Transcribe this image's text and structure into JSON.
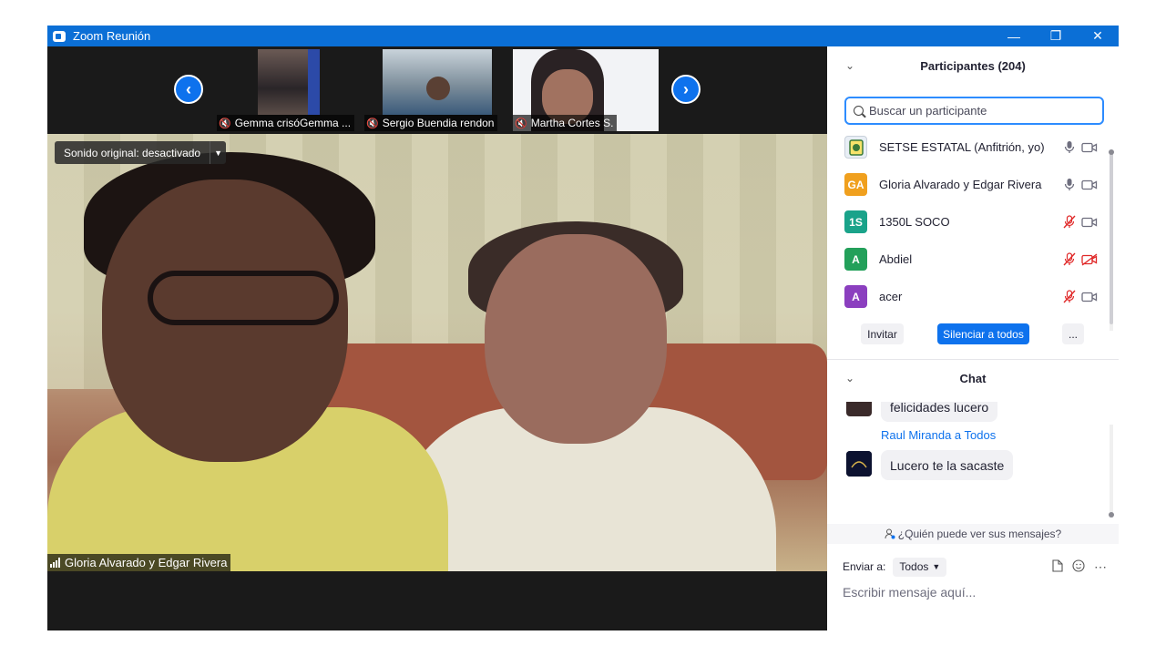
{
  "window": {
    "title": "Zoom Reunión"
  },
  "strip": {
    "thumbnails": [
      {
        "name": "Gemma crisóGemma ..."
      },
      {
        "name": "Sergio Buendia rendon"
      },
      {
        "name": "Martha Cortes S."
      }
    ]
  },
  "main_video": {
    "sound_label": "Sonido original: desactivado",
    "speaker_name": "Gloria Alvarado y Edgar Rivera"
  },
  "participants": {
    "header": "Participantes (204)",
    "search_placeholder": "Buscar un participante",
    "list": [
      {
        "name": "SETSE ESTATAL (Anfitrión, yo)",
        "initials": "",
        "color": "#e8eef5",
        "mic": "on",
        "cam": "on"
      },
      {
        "name": "Gloria Alvarado y Edgar Rivera",
        "initials": "GA",
        "color": "#f0a01e",
        "mic": "on",
        "cam": "on"
      },
      {
        "name": "1350L SOCO",
        "initials": "1S",
        "color": "#1aa38a",
        "mic": "muted",
        "cam": "on"
      },
      {
        "name": "Abdiel",
        "initials": "A",
        "color": "#23a05a",
        "mic": "muted",
        "cam": "off"
      },
      {
        "name": "acer",
        "initials": "A",
        "color": "#8b3fbf",
        "mic": "muted",
        "cam": "on"
      }
    ],
    "invite_label": "Invitar",
    "mute_all_label": "Silenciar a todos",
    "more_label": "..."
  },
  "chat": {
    "header": "Chat",
    "messages": [
      {
        "sender": "",
        "text": "felicidades lucero"
      },
      {
        "sender": "Raul Miranda a Todos",
        "text": "Lucero te la sacaste"
      }
    ],
    "who_sees_label": "¿Quién puede ver sus mensajes?",
    "send_to_label": "Enviar a:",
    "send_to_value": "Todos",
    "compose_placeholder": "Escribir mensaje aquí..."
  },
  "colors": {
    "accent": "#0e72ed",
    "titlebar": "#0b6fd6",
    "muted_red": "#e02828"
  }
}
